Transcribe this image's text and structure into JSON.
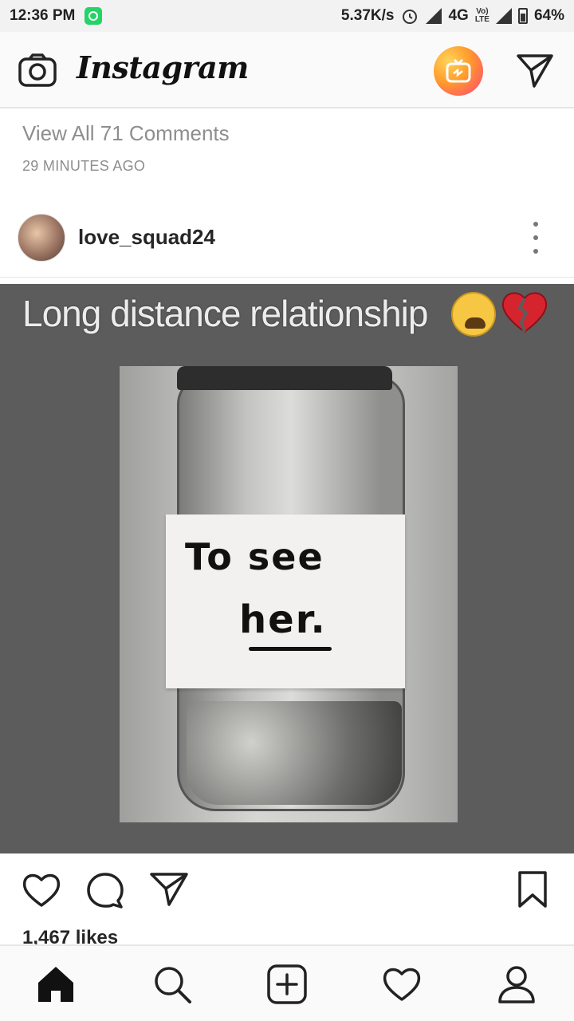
{
  "status_bar": {
    "time": "12:36 PM",
    "net_speed": "5.37K/s",
    "network": "4G",
    "volte": "Vo)\nLTE",
    "battery": "64%"
  },
  "app": {
    "title": "Instagram",
    "icons": {
      "camera": "camera-icon",
      "igtv": "igtv-icon",
      "direct": "direct-message-icon"
    }
  },
  "previous_post": {
    "view_comments": "View All 71 Comments",
    "time_ago": "29 MINUTES AGO"
  },
  "post": {
    "username": "love_squad24",
    "image": {
      "caption_line": "Long distance relationship",
      "label_line1": "To see",
      "label_line2": "her."
    },
    "likes": "1,467 likes"
  },
  "bottom_nav": [
    {
      "icon": "home-icon"
    },
    {
      "icon": "search-icon"
    },
    {
      "icon": "add-post-icon"
    },
    {
      "icon": "activity-heart-icon"
    },
    {
      "icon": "profile-icon"
    }
  ],
  "colors": {
    "igtv_gradient_start": "#ffd45a",
    "igtv_gradient_end": "#ff3d7f",
    "muted_text": "#8e8e8e"
  }
}
